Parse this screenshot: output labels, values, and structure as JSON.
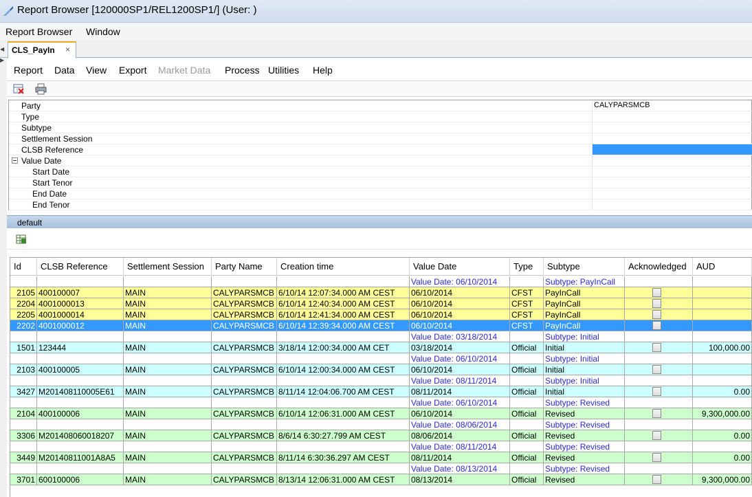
{
  "window": {
    "title": "Report Browser [120000SP1/REL1200SP1/] (User: )"
  },
  "main_menu": [
    "Report Browser",
    "Window"
  ],
  "tab": {
    "label": "CLS_PayIn",
    "close": "×"
  },
  "report_menu": [
    "Report",
    "Data",
    "View",
    "Export",
    "Market Data",
    "Process",
    "Utilities",
    "Help"
  ],
  "properties": [
    {
      "name": "Party",
      "value": "CALYPARSMCB"
    },
    {
      "name": "Type",
      "value": ""
    },
    {
      "name": "Subtype",
      "value": ""
    },
    {
      "name": "Settlement Session",
      "value": ""
    },
    {
      "name": "CLSB Reference",
      "value": ""
    },
    {
      "name": "Value Date",
      "value": ""
    },
    {
      "name": "Start Date",
      "value": ""
    },
    {
      "name": "Start Tenor",
      "value": ""
    },
    {
      "name": "End Date",
      "value": ""
    },
    {
      "name": "End Tenor",
      "value": ""
    }
  ],
  "section": {
    "label": "default"
  },
  "table": {
    "headers": [
      "Id",
      "CLSB Reference",
      "Settlement Session",
      "Party Name",
      "Creation time",
      "Value Date",
      "Type",
      "Subtype",
      "Acknowledged",
      "AUD"
    ],
    "rows": [
      {
        "kind": "group",
        "cells": [
          "",
          "",
          "",
          "",
          "",
          "Value Date: 06/10/2014",
          "",
          "Subtype: PayInCall",
          "",
          ""
        ]
      },
      {
        "kind": "yellow",
        "cells": [
          "2105",
          "400100007",
          "MAIN",
          "CALYPARSMCB",
          "6/10/14 12:07:34.000 AM CEST",
          "06/10/2014",
          "CFST",
          "PayInCall",
          "",
          ""
        ]
      },
      {
        "kind": "yellow",
        "cells": [
          "2204",
          "4001000013",
          "MAIN",
          "CALYPARSMCB",
          "6/10/14 12:40:34.000 AM CEST",
          "06/10/2014",
          "CFST",
          "PayInCall",
          "",
          ""
        ]
      },
      {
        "kind": "yellow",
        "cells": [
          "2205",
          "4001000014",
          "MAIN",
          "CALYPARSMCB",
          "6/10/14 12:41:34.000 AM CEST",
          "06/10/2014",
          "CFST",
          "PayInCall",
          "",
          ""
        ]
      },
      {
        "kind": "sel",
        "cells": [
          "2202",
          "4001000012",
          "MAIN",
          "CALYPARSMCB",
          "6/10/14 12:39:34.000 AM CEST",
          "06/10/2014",
          "CFST",
          "PayInCall",
          "",
          ""
        ]
      },
      {
        "kind": "group",
        "cells": [
          "",
          "",
          "",
          "",
          "",
          "Value Date: 03/18/2014",
          "",
          "Subtype: Initial",
          "",
          ""
        ]
      },
      {
        "kind": "cyan",
        "cells": [
          "1501",
          "123444",
          "MAIN",
          "CALYPARSMCB",
          "3/18/14 12:00:34.000 AM CET",
          "03/18/2014",
          "Official",
          "Initial",
          "",
          "100,000.00"
        ]
      },
      {
        "kind": "group",
        "cells": [
          "",
          "",
          "",
          "",
          "",
          "Value Date: 06/10/2014",
          "",
          "Subtype: Initial",
          "",
          ""
        ]
      },
      {
        "kind": "cyan",
        "cells": [
          "2103",
          "400100005",
          "MAIN",
          "CALYPARSMCB",
          "6/10/14 12:00:34.000 AM CEST",
          "06/10/2014",
          "Official",
          "Initial",
          "",
          ""
        ]
      },
      {
        "kind": "group",
        "cells": [
          "",
          "",
          "",
          "",
          "",
          "Value Date: 08/11/2014",
          "",
          "Subtype: Initial",
          "",
          ""
        ]
      },
      {
        "kind": "cyan",
        "cells": [
          "3427",
          "M201408110005E61",
          "MAIN",
          "CALYPARSMCB",
          "8/11/14 12:04:06.700 AM CEST",
          "08/11/2014",
          "Official",
          "Initial",
          "",
          "0.00"
        ]
      },
      {
        "kind": "group",
        "cells": [
          "",
          "",
          "",
          "",
          "",
          "Value Date: 06/10/2014",
          "",
          "Subtype: Revised",
          "",
          ""
        ]
      },
      {
        "kind": "green",
        "cells": [
          "2104",
          "400100006",
          "MAIN",
          "CALYPARSMCB",
          "6/10/14 12:06:31.000 AM CEST",
          "06/10/2014",
          "Official",
          "Revised",
          "",
          "9,300,000.00"
        ]
      },
      {
        "kind": "group",
        "cells": [
          "",
          "",
          "",
          "",
          "",
          "Value Date: 08/06/2014",
          "",
          "Subtype: Revised",
          "",
          ""
        ]
      },
      {
        "kind": "green",
        "cells": [
          "3306",
          "M201408060018207",
          "MAIN",
          "CALYPARSMCB",
          "8/6/14 6:30:27.799 AM CEST",
          "08/06/2014",
          "Official",
          "Revised",
          "",
          "0.00"
        ]
      },
      {
        "kind": "group",
        "cells": [
          "",
          "",
          "",
          "",
          "",
          "Value Date: 08/11/2014",
          "",
          "Subtype: Revised",
          "",
          ""
        ]
      },
      {
        "kind": "green",
        "cells": [
          "3449",
          "M20140811001A8A5",
          "MAIN",
          "CALYPARSMCB",
          "8/11/14 6:30:36.297 AM CEST",
          "08/11/2014",
          "Official",
          "Revised",
          "",
          "0.00"
        ]
      },
      {
        "kind": "group",
        "cells": [
          "",
          "",
          "",
          "",
          "",
          "Value Date: 08/13/2014",
          "",
          "Subtype: Revised",
          "",
          ""
        ]
      },
      {
        "kind": "green",
        "cells": [
          "3701",
          "600100006",
          "MAIN",
          "CALYPARSMCB",
          "8/13/14 12:06:31.000 AM CEST",
          "08/13/2014",
          "Official",
          "Revised",
          "",
          "9,300,000.00"
        ]
      }
    ]
  },
  "colors": {
    "yellow_row": "#ffff99",
    "cyan_row": "#ccffff",
    "green_row": "#ccffcc",
    "selected_row": "#3399ff",
    "group_text": "#2a2ad8"
  },
  "icons": {
    "clear_filter": "clear-filter-icon",
    "print": "print-icon",
    "export_excel": "export-excel-icon"
  }
}
